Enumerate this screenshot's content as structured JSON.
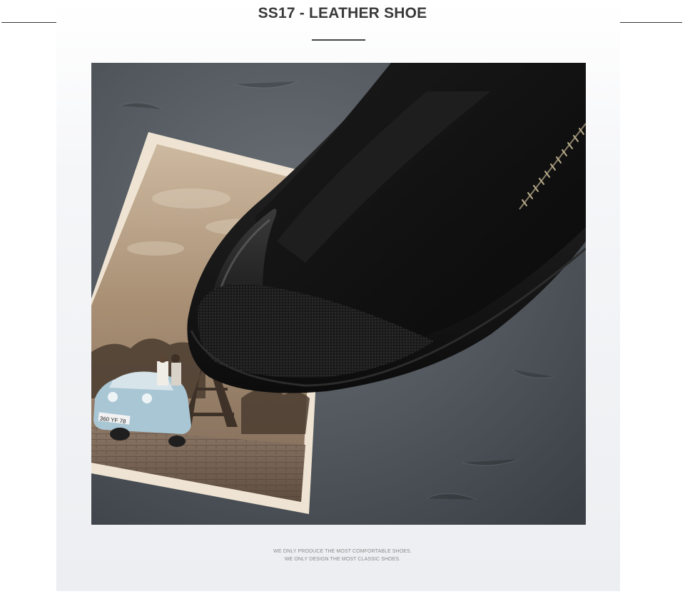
{
  "header": {
    "title": "SS17 - LEATHER SHOE"
  },
  "product_photo": {
    "postcard_plate": "360 YF 78"
  },
  "footer": {
    "line1": "WE ONLY PRODUCE THE MOST COMFORTABLE SHOES.",
    "line2": "WE ONLY DESIGN THE MOST CLASSIC SHOES."
  },
  "colors": {
    "background": "#ffffff",
    "panel": "#eef0f3",
    "title": "#3a3a3a",
    "felt": "#4e545a",
    "shoe": "#141414"
  },
  "icons": []
}
